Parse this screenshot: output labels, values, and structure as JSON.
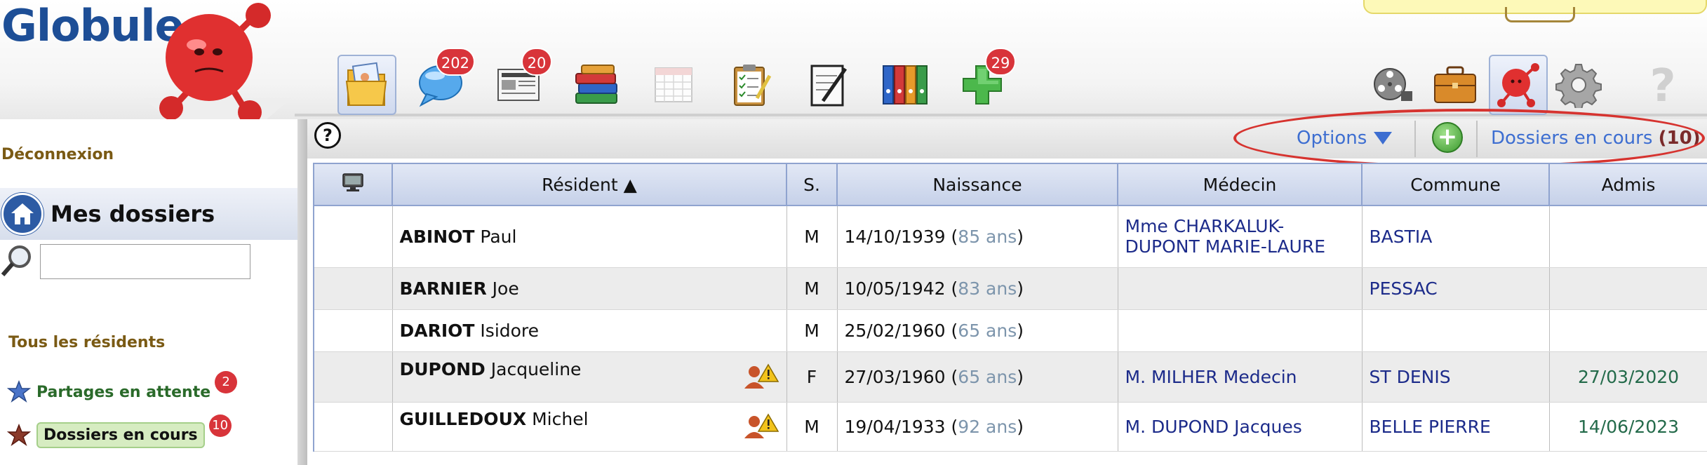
{
  "app": {
    "logo_text": "Globule"
  },
  "toolbar": {
    "icons": [
      {
        "name": "folder-icon",
        "badge": null,
        "active": true
      },
      {
        "name": "chat-bubble-icon",
        "badge": "202",
        "active": false
      },
      {
        "name": "newspaper-icon",
        "badge": "20",
        "active": false
      },
      {
        "name": "books-icon",
        "badge": null,
        "active": false
      },
      {
        "name": "calendar-icon",
        "badge": null,
        "active": false
      },
      {
        "name": "clipboard-checklist-icon",
        "badge": null,
        "active": false
      },
      {
        "name": "notepad-pen-icon",
        "badge": null,
        "active": false
      },
      {
        "name": "binders-icon",
        "badge": null,
        "active": false
      },
      {
        "name": "medical-cross-icon",
        "badge": "29",
        "active": false
      }
    ],
    "right_icons": [
      {
        "name": "film-reel-icon",
        "active": false
      },
      {
        "name": "briefcase-icon",
        "active": false
      },
      {
        "name": "globule-mascot-icon",
        "active": true
      },
      {
        "name": "gear-icon",
        "active": false
      },
      {
        "name": "question-mark-icon",
        "active": false
      }
    ]
  },
  "sidebar": {
    "logout": "Déconnexion",
    "my_files": "Mes dossiers",
    "search_placeholder": "",
    "all_residents": "Tous les résidents",
    "entries": [
      {
        "label": "Partages en attente",
        "badge": "2",
        "selected": false,
        "star_color": "#4a74c9"
      },
      {
        "label": "Dossiers en cours",
        "badge": "10",
        "selected": true,
        "star_color": "#8a3a2a"
      }
    ]
  },
  "main": {
    "help": "?",
    "options_label": "Options",
    "add_label": "+",
    "current_files_label": "Dossiers en cours",
    "current_files_count": "(10)"
  },
  "table": {
    "headers": [
      "",
      "Résident ▲",
      "S.",
      "Naissance",
      "Médecin",
      "Commune",
      "Admis"
    ],
    "rows": [
      {
        "last": "ABINOT",
        "first": "Paul",
        "alert": false,
        "sex": "M",
        "birth": "14/10/1939",
        "age": "85 ans",
        "doctor": "Mme CHARKALUK-DUPONT MARIE-LAURE",
        "town": "BASTIA",
        "admis": ""
      },
      {
        "last": "BARNIER",
        "first": "Joe",
        "alert": false,
        "sex": "M",
        "birth": "10/05/1942",
        "age": "83 ans",
        "doctor": "",
        "town": "PESSAC",
        "admis": ""
      },
      {
        "last": "DARIOT",
        "first": "Isidore",
        "alert": false,
        "sex": "M",
        "birth": "25/02/1960",
        "age": "65 ans",
        "doctor": "",
        "town": "",
        "admis": ""
      },
      {
        "last": "DUPOND",
        "first": "Jacqueline",
        "alert": true,
        "sex": "F",
        "birth": "27/03/1960",
        "age": "65 ans",
        "doctor": "M. MILHER Medecin",
        "town": "ST DENIS",
        "admis": "27/03/2020"
      },
      {
        "last": "GUILLEDOUX",
        "first": "Michel",
        "alert": true,
        "sex": "M",
        "birth": "19/04/1933",
        "age": "92 ans",
        "doctor": "M. DUPOND Jacques",
        "town": "BELLE PIERRE",
        "admis": "14/06/2023"
      }
    ]
  }
}
